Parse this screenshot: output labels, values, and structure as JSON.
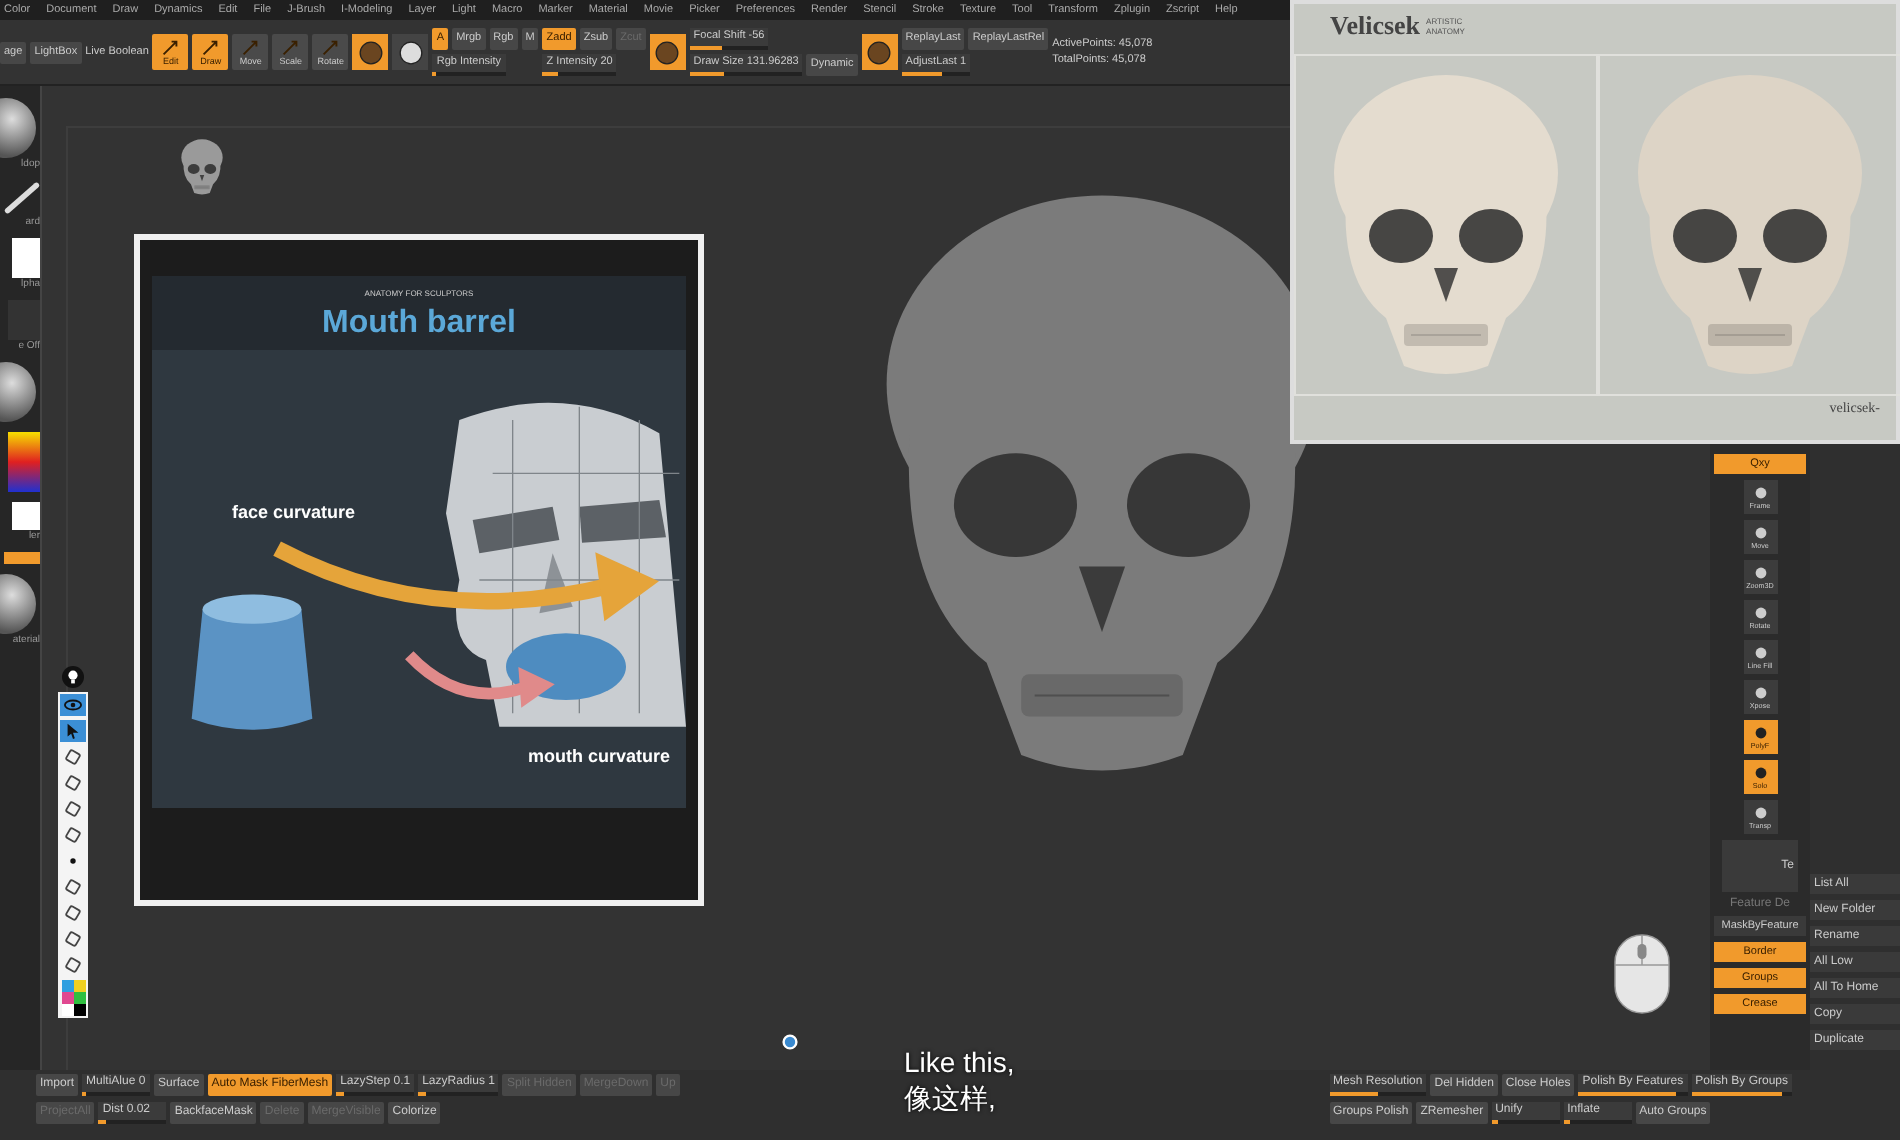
{
  "menu_bar": [
    "Color",
    "Document",
    "Draw",
    "Dynamics",
    "Edit",
    "File",
    "J-Brush",
    "I-Modeling",
    "Layer",
    "Light",
    "Macro",
    "Marker",
    "Material",
    "Movie",
    "Picker",
    "Preferences",
    "Render",
    "Stencil",
    "Stroke",
    "Texture",
    "Tool",
    "Transform",
    "Zplugin",
    "Zscript",
    "Help"
  ],
  "toolbar": [
    [
      [
        {
          "kind": "button",
          "label": "age",
          "selected": false,
          "disabled": false
        }
      ]
    ],
    [
      [
        {
          "kind": "button",
          "label": "LightBox",
          "selected": false,
          "disabled": false
        }
      ]
    ],
    [
      [
        {
          "kind": "text",
          "label": "Live Boolean"
        }
      ]
    ],
    [
      [
        {
          "kind": "tool",
          "label": "Edit",
          "selected": true
        },
        {
          "kind": "tool",
          "label": "Draw",
          "selected": true
        },
        {
          "kind": "tool",
          "label": "Move",
          "selected": false
        },
        {
          "kind": "tool",
          "label": "Scale",
          "selected": false
        },
        {
          "kind": "tool",
          "label": "Rotate",
          "selected": false
        }
      ]
    ],
    [
      [
        {
          "kind": "icon",
          "selected": true
        },
        {
          "kind": "icon",
          "selected": false
        }
      ]
    ],
    [
      [
        {
          "kind": "button",
          "label": "A",
          "selected": true,
          "disabled": false
        },
        {
          "kind": "button",
          "label": "Mrgb",
          "selected": false,
          "disabled": false
        },
        {
          "kind": "button",
          "label": "Rgb",
          "selected": false,
          "disabled": false
        },
        {
          "kind": "button",
          "label": "M",
          "selected": false,
          "disabled": false
        }
      ],
      [
        {
          "kind": "slider",
          "label": "Rgb Intensity",
          "level": 0
        }
      ]
    ],
    [
      [
        {
          "kind": "button",
          "label": "Zadd",
          "selected": true,
          "disabled": false
        },
        {
          "kind": "button",
          "label": "Zsub",
          "selected": false,
          "disabled": false
        },
        {
          "kind": "button",
          "label": "Zcut",
          "selected": false,
          "disabled": true
        }
      ],
      [
        {
          "kind": "slider",
          "label": "Z Intensity 20",
          "level": 0.2
        }
      ]
    ],
    [
      [
        {
          "kind": "icon",
          "selected": true
        }
      ]
    ],
    [
      [
        {
          "kind": "slider",
          "label": "Focal Shift -56",
          "level": 0.4
        }
      ],
      [
        {
          "kind": "slider",
          "label": "Draw Size 131.96283",
          "level": 0.3
        },
        {
          "kind": "button",
          "label": "Dynamic",
          "selected": false,
          "disabled": false
        }
      ]
    ],
    [
      [
        {
          "kind": "icon",
          "selected": true
        }
      ]
    ],
    [
      [
        {
          "kind": "button",
          "label": "ReplayLast",
          "selected": false,
          "disabled": false
        },
        {
          "kind": "button",
          "label": "ReplayLastRel",
          "selected": false,
          "disabled": false
        }
      ],
      [
        {
          "kind": "slider",
          "label": "AdjustLast 1",
          "level": 0.6
        }
      ]
    ],
    [
      [
        {
          "kind": "text",
          "label": "ActivePoints: 45,078"
        }
      ],
      [
        {
          "kind": "text",
          "label": "TotalPoints: 45,078"
        }
      ]
    ]
  ],
  "left_shelf": [
    {
      "kind": "sphere",
      "label": "ldop"
    },
    {
      "kind": "stroke",
      "label": "ard"
    },
    {
      "kind": "alpha",
      "label": "lpha"
    },
    {
      "kind": "texture",
      "label": "e Off"
    },
    {
      "kind": "sphere"
    },
    {
      "kind": "color"
    },
    {
      "kind": "swatch",
      "label": "ler"
    },
    {
      "kind": "bar"
    },
    {
      "kind": "sphere",
      "label": "aterial"
    }
  ],
  "toolbox": [
    {
      "kind": "eye",
      "selected": true
    },
    {
      "kind": "cursor",
      "selected": true
    },
    {
      "kind": "tool",
      "selected": false
    },
    {
      "kind": "tool",
      "selected": false
    },
    {
      "kind": "tool",
      "selected": false
    },
    {
      "kind": "tool",
      "selected": false
    },
    {
      "kind": "dot",
      "selected": false
    },
    {
      "kind": "tool",
      "selected": false
    },
    {
      "kind": "tool",
      "selected": false
    },
    {
      "kind": "tool",
      "selected": false
    },
    {
      "kind": "tool",
      "selected": false
    }
  ],
  "swatches": [
    {
      "color": "#2f9fe0"
    },
    {
      "color": "#f0d020"
    },
    {
      "color": "#e04890"
    },
    {
      "color": "#30c040"
    },
    {
      "color": "#ffffff"
    },
    {
      "color": "#000000"
    }
  ],
  "reference_card": {
    "logo": "ANATOMY FOR SCULPTORS",
    "title": "Mouth barrel",
    "labels": [
      "face curvature",
      "mouth curvature"
    ]
  },
  "subtitles": [
    "Like this,",
    "像这样,"
  ],
  "reference_image": {
    "brand": "Velicsek",
    "tagline": "ARTISTIC ANATOMY",
    "credit": "velicsek-"
  },
  "right_shelf": [
    {
      "kind": "button",
      "label": "Qxy",
      "selected": true
    },
    {
      "kind": "tool",
      "label": "Frame",
      "selected": false
    },
    {
      "kind": "tool",
      "label": "Move",
      "selected": false
    },
    {
      "kind": "tool",
      "label": "Zoom3D",
      "selected": false
    },
    {
      "kind": "tool",
      "label": "Rotate",
      "selected": false
    },
    {
      "kind": "tool",
      "label": "Line Fill",
      "selected": false
    },
    {
      "kind": "tool",
      "label": "Xpose",
      "selected": false
    },
    {
      "kind": "tool",
      "label": "PolyF",
      "selected": true
    },
    {
      "kind": "tool",
      "label": "Solo",
      "selected": true
    },
    {
      "kind": "tool",
      "label": "Transp",
      "selected": false
    },
    {
      "kind": "preview",
      "label": "Te",
      "selected": false
    },
    {
      "kind": "text",
      "label": "Feature De"
    },
    {
      "kind": "button",
      "label": "MaskByFeature",
      "selected": false
    },
    {
      "kind": "button",
      "label": "Border",
      "selected": true
    },
    {
      "kind": "button",
      "label": "Groups",
      "selected": true
    },
    {
      "kind": "button",
      "label": "Crease",
      "selected": true
    }
  ],
  "right_panel": [
    "List All",
    "New Folder",
    "Rename",
    "All Low",
    "All To Home",
    "Copy",
    "Duplicate"
  ],
  "bottom_bar": {
    "left": [
      [
        {
          "kind": "button",
          "label": "Import",
          "selected": false,
          "disabled": false
        },
        {
          "kind": "slider",
          "label": "MultiAlue 0",
          "level": 0
        },
        {
          "kind": "button",
          "label": "Surface",
          "selected": false,
          "disabled": false
        },
        {
          "kind": "button",
          "label": "Auto Mask FiberMesh",
          "selected": true,
          "disabled": false
        },
        {
          "kind": "slider",
          "label": "LazyStep 0.1",
          "level": 0.1
        },
        {
          "kind": "slider",
          "label": "LazyRadius 1",
          "level": 0.1
        },
        {
          "kind": "button",
          "label": "Split Hidden",
          "selected": false,
          "disabled": true
        },
        {
          "kind": "button",
          "label": "MergeDown",
          "selected": false,
          "disabled": true
        },
        {
          "kind": "button",
          "label": "Up",
          "selected": false,
          "disabled": true
        }
      ],
      [
        {
          "kind": "button",
          "label": "ProjectAll",
          "selected": false,
          "disabled": true
        },
        {
          "kind": "slider",
          "label": "Dist 0.02",
          "level": 0.1
        },
        {
          "kind": "button",
          "label": "BackfaceMask",
          "selected": false,
          "disabled": false
        },
        {
          "kind": "button",
          "label": "Delete",
          "selected": false,
          "disabled": true
        },
        {
          "kind": "button",
          "label": "MergeVisible",
          "selected": false,
          "disabled": true
        },
        {
          "kind": "button",
          "label": "Colorize",
          "selected": false,
          "disabled": false
        }
      ]
    ],
    "right": [
      [
        {
          "kind": "slider",
          "label": "Mesh Resolution",
          "level": 0.5
        },
        {
          "kind": "button",
          "label": "Del Hidden",
          "selected": false,
          "disabled": false
        },
        {
          "kind": "button",
          "label": "Close Holes",
          "selected": false,
          "disabled": false
        },
        {
          "kind": "slider",
          "label": "Polish By Features",
          "level": 0.9
        },
        {
          "kind": "slider",
          "label": "Polish By Groups",
          "level": 0.9
        }
      ],
      [
        {
          "kind": "button",
          "label": "Groups Polish",
          "selected": false,
          "disabled": false
        },
        {
          "kind": "button",
          "label": "ZRemesher",
          "selected": false,
          "disabled": false
        },
        {
          "kind": "slider",
          "label": "Unify",
          "level": 0.1
        },
        {
          "kind": "slider",
          "label": "Inflate",
          "level": 0.1
        },
        {
          "kind": "button",
          "label": "Auto Groups",
          "selected": false,
          "disabled": false
        }
      ]
    ]
  }
}
